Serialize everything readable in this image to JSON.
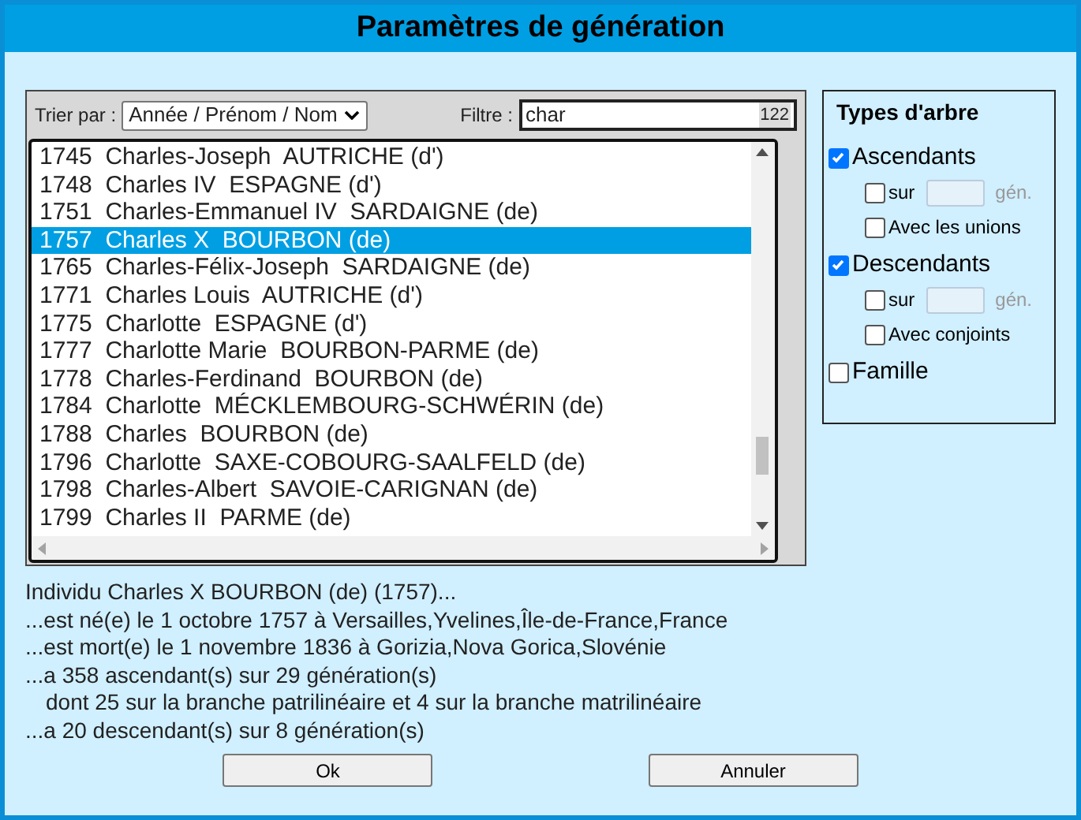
{
  "window": {
    "title": "Paramètres de génération"
  },
  "sort": {
    "label": "Trier par :",
    "value": "Année / Prénom / Nom"
  },
  "filter": {
    "label": "Filtre :",
    "value": "char",
    "count": "122"
  },
  "people": [
    {
      "year": "1745",
      "given": "Charles-Joseph",
      "surname": "AUTRICHE (d')",
      "selected": false
    },
    {
      "year": "1748",
      "given": "Charles IV",
      "surname": "ESPAGNE (d')",
      "selected": false
    },
    {
      "year": "1751",
      "given": "Charles-Emmanuel IV",
      "surname": "SARDAIGNE (de)",
      "selected": false
    },
    {
      "year": "1757",
      "given": "Charles X",
      "surname": "BOURBON (de)",
      "selected": true
    },
    {
      "year": "1765",
      "given": "Charles-Félix-Joseph",
      "surname": "SARDAIGNE (de)",
      "selected": false
    },
    {
      "year": "1771",
      "given": "Charles Louis",
      "surname": "AUTRICHE (d')",
      "selected": false
    },
    {
      "year": "1775",
      "given": "Charlotte",
      "surname": "ESPAGNE (d')",
      "selected": false
    },
    {
      "year": "1777",
      "given": "Charlotte Marie",
      "surname": "BOURBON-PARME (de)",
      "selected": false
    },
    {
      "year": "1778",
      "given": "Charles-Ferdinand",
      "surname": "BOURBON (de)",
      "selected": false
    },
    {
      "year": "1784",
      "given": "Charlotte",
      "surname": "MÉCKLEMBOURG-SCHWÉRIN (de)",
      "selected": false
    },
    {
      "year": "1788",
      "given": "Charles",
      "surname": "BOURBON (de)",
      "selected": false
    },
    {
      "year": "1796",
      "given": "Charlotte",
      "surname": "SAXE-COBOURG-SAALFELD (de)",
      "selected": false
    },
    {
      "year": "1798",
      "given": "Charles-Albert",
      "surname": "SAVOIE-CARIGNAN (de)",
      "selected": false
    },
    {
      "year": "1799",
      "given": "Charles II",
      "surname": "PARME (de)",
      "selected": false
    }
  ],
  "tree_types": {
    "title": "Types d'arbre",
    "options": [
      {
        "kind": "main",
        "label": "Ascendants",
        "checked": true
      },
      {
        "kind": "generations",
        "label": "sur",
        "unit": "gén.",
        "checked": false
      },
      {
        "kind": "sub",
        "label": "Avec les unions",
        "checked": false
      },
      {
        "kind": "main",
        "label": "Descendants",
        "checked": true
      },
      {
        "kind": "generations",
        "label": "sur",
        "unit": "gén.",
        "checked": false
      },
      {
        "kind": "sub",
        "label": "Avec conjoints",
        "checked": false
      },
      {
        "kind": "main",
        "label": "Famille",
        "checked": false
      }
    ]
  },
  "info": [
    {
      "text": "Individu Charles X BOURBON (de) (1757)...",
      "indented": false
    },
    {
      "text": "...est né(e) le 1 octobre 1757 à Versailles,Yvelines,Île-de-France,France",
      "indented": false
    },
    {
      "text": "...est mort(e) le 1 novembre 1836 à Gorizia,Nova Gorica,Slovénie",
      "indented": false
    },
    {
      "text": "...a 358 ascendant(s) sur 29 génération(s)",
      "indented": false
    },
    {
      "text": "dont 25 sur la branche patrilinéaire et 4 sur la branche matrilinéaire",
      "indented": true
    },
    {
      "text": "...a 20 descendant(s) sur 8 génération(s)",
      "indented": false
    }
  ],
  "buttons": [
    "Ok",
    "Annuler"
  ]
}
